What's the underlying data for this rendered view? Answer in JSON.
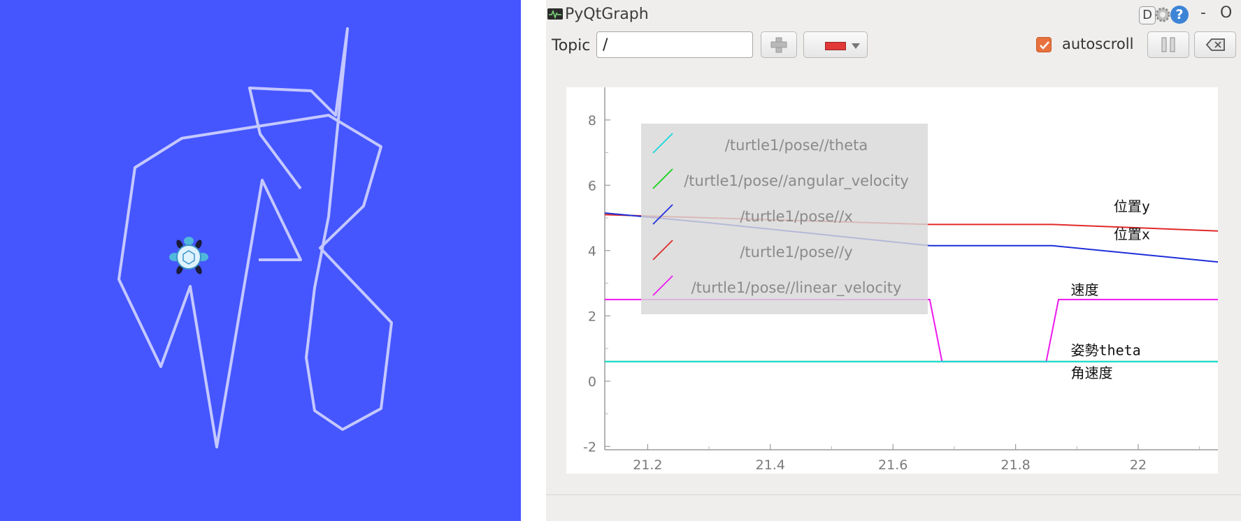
{
  "window": {
    "title": "PyQtGraph",
    "btn_d": "D",
    "btn_help": "?",
    "btn_min": "-",
    "btn_close": "O"
  },
  "toolbar": {
    "topic_label": "Topic",
    "topic_value": "/",
    "autoscroll_label": "autoscroll",
    "autoscroll_checked": true,
    "color_button_swatch": "#e13838"
  },
  "icons": [
    "app-icon",
    "gear-icon",
    "help-icon",
    "add-icon",
    "color-caret-icon",
    "pause-icon",
    "clear-icon",
    "turtle-icon"
  ],
  "turtle_sim": {
    "background": "#4556ff",
    "trail_color": "#c4c8ff"
  },
  "legend": [
    {
      "label": "/turtle1/pose//theta",
      "color": "#17d9d9"
    },
    {
      "label": "/turtle1/pose//angular_velocity",
      "color": "#19d01e"
    },
    {
      "label": "/turtle1/pose//x",
      "color": "#1f2fd8"
    },
    {
      "label": "/turtle1/pose//y",
      "color": "#e02a2a"
    },
    {
      "label": "/turtle1/pose//linear_velocity",
      "color": "#ee18ee"
    }
  ],
  "annotations": [
    {
      "text": "位置y",
      "x": 21.96,
      "y": 5.2
    },
    {
      "text": "位置x",
      "x": 21.96,
      "y": 4.35
    },
    {
      "text": "速度",
      "x": 21.89,
      "y": 2.65
    },
    {
      "text": "姿勢theta",
      "x": 21.89,
      "y": 0.8
    },
    {
      "text": "角速度",
      "x": 21.89,
      "y": 0.1
    }
  ],
  "chart_data": {
    "type": "line",
    "xlim": [
      21.13,
      22.13
    ],
    "ylim": [
      -2.1,
      9.0
    ],
    "x_ticks": [
      21.2,
      21.4,
      21.6,
      21.8,
      22
    ],
    "x_tick_labels": [
      "21.2",
      "21.4",
      "21.6",
      "21.8",
      "22"
    ],
    "y_ticks": [
      -2,
      0,
      2,
      4,
      6,
      8
    ],
    "y_tick_labels": [
      "-2",
      "0",
      "2",
      "4",
      "6",
      "8"
    ],
    "grid": false,
    "legend_position": "top-left",
    "series": [
      {
        "name": "/turtle1/pose//y",
        "color": "#e02a2a",
        "x": [
          21.13,
          21.3,
          21.66,
          21.86,
          22.13
        ],
        "y": [
          5.1,
          5.0,
          4.8,
          4.8,
          4.6
        ]
      },
      {
        "name": "/turtle1/pose//x",
        "color": "#1f2fd8",
        "x": [
          21.13,
          21.3,
          21.66,
          21.86,
          22.13
        ],
        "y": [
          5.15,
          4.85,
          4.15,
          4.15,
          3.65
        ]
      },
      {
        "name": "/turtle1/pose//linear_velocity",
        "color": "#ee18ee",
        "x": [
          21.13,
          21.66,
          21.68,
          21.85,
          21.87,
          22.13
        ],
        "y": [
          2.5,
          2.5,
          0.6,
          0.6,
          2.5,
          2.5
        ]
      },
      {
        "name": "/turtle1/pose//angular_velocity",
        "color": "#19d01e",
        "x": [
          21.13,
          22.13
        ],
        "y": [
          0.6,
          0.6
        ]
      },
      {
        "name": "/turtle1/pose//theta",
        "color": "#17d9d9",
        "x": [
          21.13,
          22.13
        ],
        "y": [
          0.6,
          0.6
        ]
      }
    ]
  }
}
